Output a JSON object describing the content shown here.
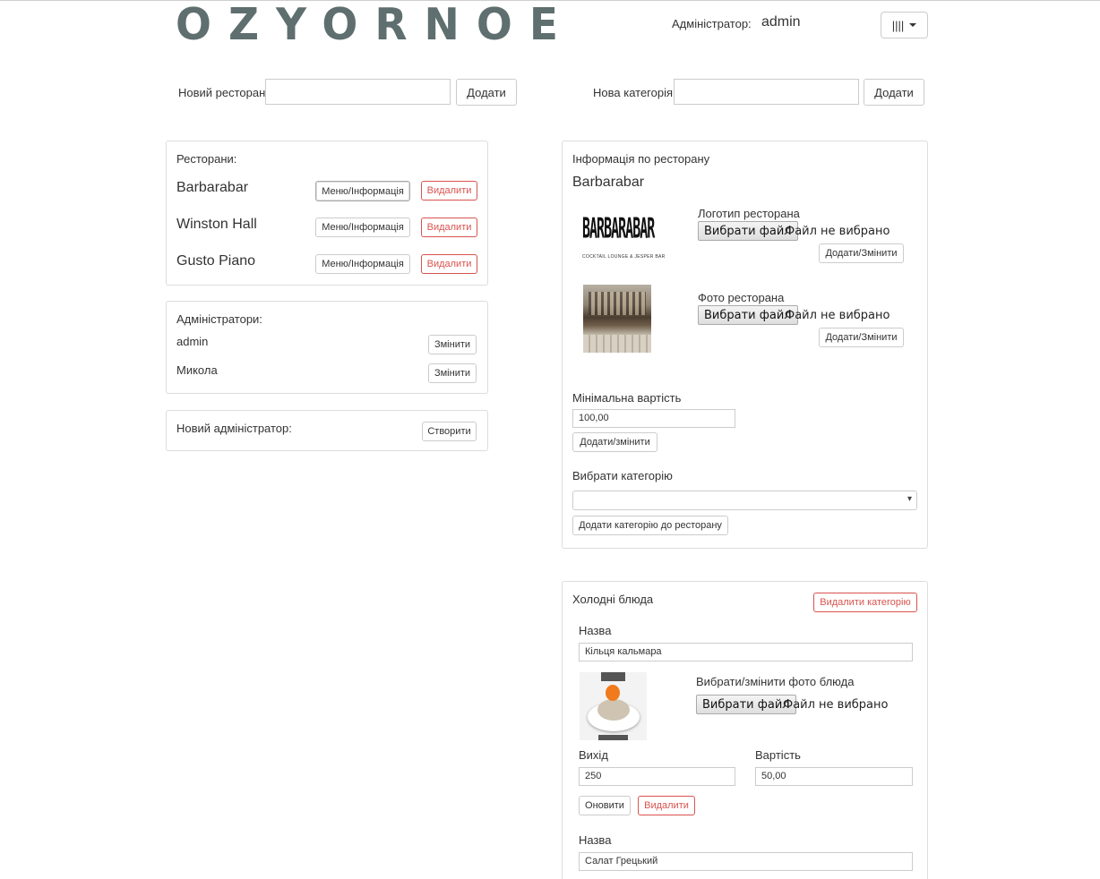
{
  "header": {
    "logo": "OZYORNOE",
    "admin_label": "Адміністратор:",
    "admin_name": "admin",
    "menu_icon": "||||"
  },
  "top_forms": {
    "new_restaurant_label": "Новий ресторан",
    "new_restaurant_value": "",
    "add_restaurant": "Додати",
    "new_category_label": "Нова категорія",
    "new_category_value": "",
    "add_category": "Додати"
  },
  "restaurants": {
    "title": "Ресторани:",
    "menu_label": "Меню/Інформація",
    "delete_label": "Видалити",
    "items": [
      {
        "name": "Barbarabar"
      },
      {
        "name": "Winston Hall"
      },
      {
        "name": "Gusto Piano"
      }
    ]
  },
  "admins": {
    "title": "Адміністратори:",
    "edit_label": "Змінити",
    "items": [
      {
        "name": "admin"
      },
      {
        "name": "Микола"
      }
    ]
  },
  "new_admin": {
    "title": "Новий адміністратор:",
    "create_label": "Створити"
  },
  "info": {
    "title": "Інформація по ресторану",
    "restaurant_name": "Barbarabar",
    "logo_image_text": "BARBARABAR",
    "logo_image_subtext": "COCKTAIL LOUNGE & JESPER BAR",
    "logo_label": "Логотип ресторана",
    "photo_label": "Фото ресторана",
    "choose_file": "Вибрати файл",
    "no_file": "Файл не вибрано",
    "add_change": "Додати/Змінити",
    "min_cost_label": "Мінімальна вартість",
    "min_cost_value": "100,00",
    "min_cost_button": "Додати/змінити",
    "choose_category_label": "Вибрати категорію",
    "category_selected": "",
    "add_category_button": "Додати категорію до ресторану"
  },
  "category": {
    "title": "Холодні блюда",
    "delete_category": "Видалити категорію",
    "name_label": "Назва",
    "photo_label": "Вибрати/змінити фото блюда",
    "choose_file": "Вибрати файл",
    "no_file": "Файл не вибрано",
    "yield_label": "Вихід",
    "cost_label": "Вартість",
    "update_label": "Оновити",
    "delete_label": "Видалити",
    "dishes": [
      {
        "name": "Кільця кальмара",
        "yield": "250",
        "cost": "50,00"
      },
      {
        "name": "Салат Грецький"
      }
    ]
  },
  "colors": {
    "logo": "#5f6e6e",
    "danger": "#d9534f",
    "border": "#dddddd"
  }
}
